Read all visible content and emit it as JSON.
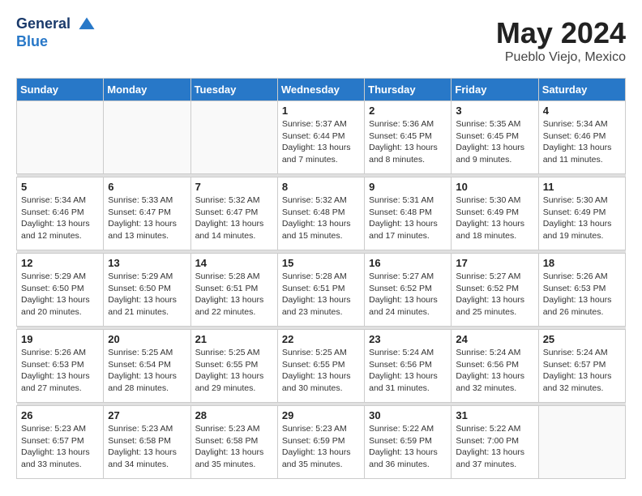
{
  "header": {
    "logo": {
      "general": "General",
      "blue": "Blue"
    },
    "title": "May 2024",
    "location": "Pueblo Viejo, Mexico"
  },
  "calendar": {
    "weekdays": [
      "Sunday",
      "Monday",
      "Tuesday",
      "Wednesday",
      "Thursday",
      "Friday",
      "Saturday"
    ],
    "weeks": [
      [
        {
          "day": "",
          "info": ""
        },
        {
          "day": "",
          "info": ""
        },
        {
          "day": "",
          "info": ""
        },
        {
          "day": "1",
          "info": "Sunrise: 5:37 AM\nSunset: 6:44 PM\nDaylight: 13 hours\nand 7 minutes."
        },
        {
          "day": "2",
          "info": "Sunrise: 5:36 AM\nSunset: 6:45 PM\nDaylight: 13 hours\nand 8 minutes."
        },
        {
          "day": "3",
          "info": "Sunrise: 5:35 AM\nSunset: 6:45 PM\nDaylight: 13 hours\nand 9 minutes."
        },
        {
          "day": "4",
          "info": "Sunrise: 5:34 AM\nSunset: 6:46 PM\nDaylight: 13 hours\nand 11 minutes."
        }
      ],
      [
        {
          "day": "5",
          "info": "Sunrise: 5:34 AM\nSunset: 6:46 PM\nDaylight: 13 hours\nand 12 minutes."
        },
        {
          "day": "6",
          "info": "Sunrise: 5:33 AM\nSunset: 6:47 PM\nDaylight: 13 hours\nand 13 minutes."
        },
        {
          "day": "7",
          "info": "Sunrise: 5:32 AM\nSunset: 6:47 PM\nDaylight: 13 hours\nand 14 minutes."
        },
        {
          "day": "8",
          "info": "Sunrise: 5:32 AM\nSunset: 6:48 PM\nDaylight: 13 hours\nand 15 minutes."
        },
        {
          "day": "9",
          "info": "Sunrise: 5:31 AM\nSunset: 6:48 PM\nDaylight: 13 hours\nand 17 minutes."
        },
        {
          "day": "10",
          "info": "Sunrise: 5:30 AM\nSunset: 6:49 PM\nDaylight: 13 hours\nand 18 minutes."
        },
        {
          "day": "11",
          "info": "Sunrise: 5:30 AM\nSunset: 6:49 PM\nDaylight: 13 hours\nand 19 minutes."
        }
      ],
      [
        {
          "day": "12",
          "info": "Sunrise: 5:29 AM\nSunset: 6:50 PM\nDaylight: 13 hours\nand 20 minutes."
        },
        {
          "day": "13",
          "info": "Sunrise: 5:29 AM\nSunset: 6:50 PM\nDaylight: 13 hours\nand 21 minutes."
        },
        {
          "day": "14",
          "info": "Sunrise: 5:28 AM\nSunset: 6:51 PM\nDaylight: 13 hours\nand 22 minutes."
        },
        {
          "day": "15",
          "info": "Sunrise: 5:28 AM\nSunset: 6:51 PM\nDaylight: 13 hours\nand 23 minutes."
        },
        {
          "day": "16",
          "info": "Sunrise: 5:27 AM\nSunset: 6:52 PM\nDaylight: 13 hours\nand 24 minutes."
        },
        {
          "day": "17",
          "info": "Sunrise: 5:27 AM\nSunset: 6:52 PM\nDaylight: 13 hours\nand 25 minutes."
        },
        {
          "day": "18",
          "info": "Sunrise: 5:26 AM\nSunset: 6:53 PM\nDaylight: 13 hours\nand 26 minutes."
        }
      ],
      [
        {
          "day": "19",
          "info": "Sunrise: 5:26 AM\nSunset: 6:53 PM\nDaylight: 13 hours\nand 27 minutes."
        },
        {
          "day": "20",
          "info": "Sunrise: 5:25 AM\nSunset: 6:54 PM\nDaylight: 13 hours\nand 28 minutes."
        },
        {
          "day": "21",
          "info": "Sunrise: 5:25 AM\nSunset: 6:55 PM\nDaylight: 13 hours\nand 29 minutes."
        },
        {
          "day": "22",
          "info": "Sunrise: 5:25 AM\nSunset: 6:55 PM\nDaylight: 13 hours\nand 30 minutes."
        },
        {
          "day": "23",
          "info": "Sunrise: 5:24 AM\nSunset: 6:56 PM\nDaylight: 13 hours\nand 31 minutes."
        },
        {
          "day": "24",
          "info": "Sunrise: 5:24 AM\nSunset: 6:56 PM\nDaylight: 13 hours\nand 32 minutes."
        },
        {
          "day": "25",
          "info": "Sunrise: 5:24 AM\nSunset: 6:57 PM\nDaylight: 13 hours\nand 32 minutes."
        }
      ],
      [
        {
          "day": "26",
          "info": "Sunrise: 5:23 AM\nSunset: 6:57 PM\nDaylight: 13 hours\nand 33 minutes."
        },
        {
          "day": "27",
          "info": "Sunrise: 5:23 AM\nSunset: 6:58 PM\nDaylight: 13 hours\nand 34 minutes."
        },
        {
          "day": "28",
          "info": "Sunrise: 5:23 AM\nSunset: 6:58 PM\nDaylight: 13 hours\nand 35 minutes."
        },
        {
          "day": "29",
          "info": "Sunrise: 5:23 AM\nSunset: 6:59 PM\nDaylight: 13 hours\nand 35 minutes."
        },
        {
          "day": "30",
          "info": "Sunrise: 5:22 AM\nSunset: 6:59 PM\nDaylight: 13 hours\nand 36 minutes."
        },
        {
          "day": "31",
          "info": "Sunrise: 5:22 AM\nSunset: 7:00 PM\nDaylight: 13 hours\nand 37 minutes."
        },
        {
          "day": "",
          "info": ""
        }
      ]
    ]
  }
}
